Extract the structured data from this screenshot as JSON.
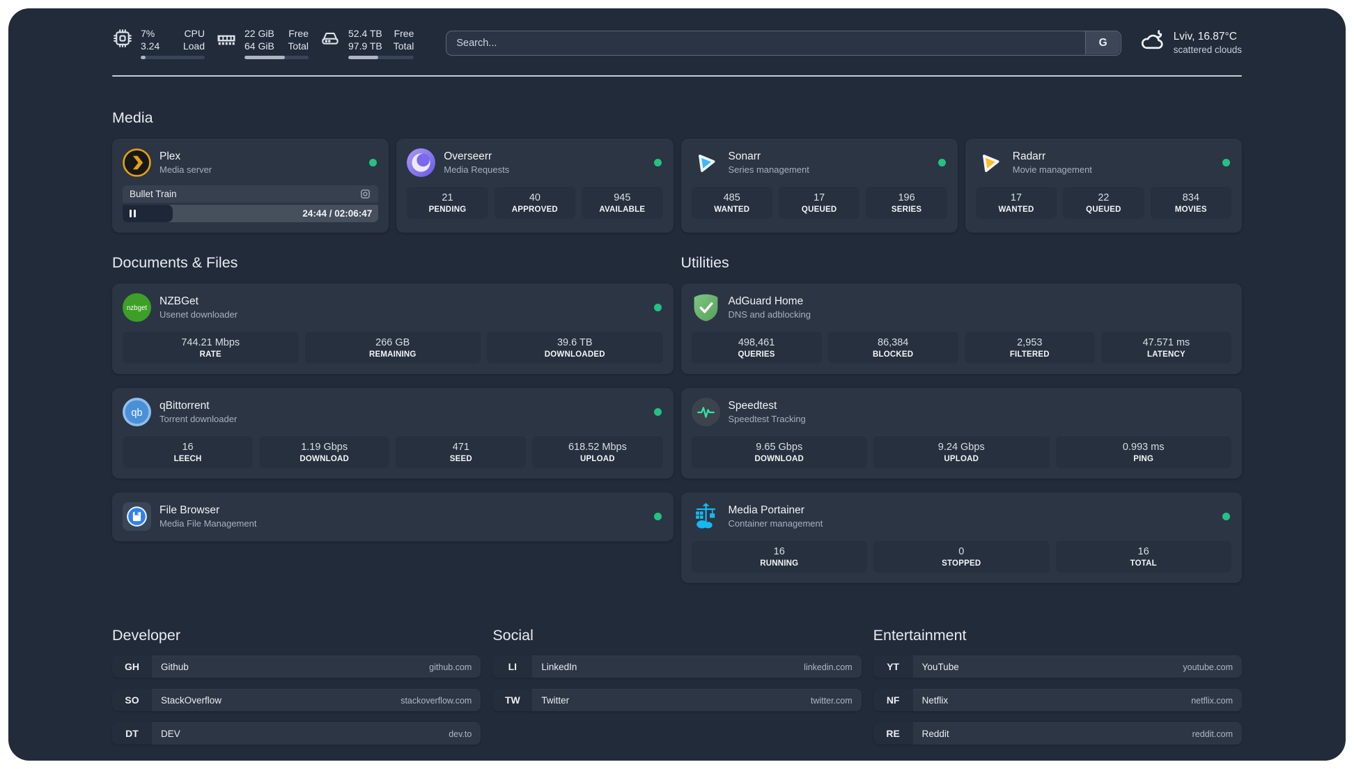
{
  "header": {
    "resources": [
      {
        "icon": "cpu-icon",
        "rows": [
          {
            "value": "7%",
            "label": "CPU"
          },
          {
            "value": "3.24",
            "label": "Load"
          }
        ],
        "fill_pct": 8
      },
      {
        "icon": "memory-icon",
        "rows": [
          {
            "value": "22 GiB",
            "label": "Free"
          },
          {
            "value": "64 GiB",
            "label": "Total"
          }
        ],
        "fill_pct": 63
      },
      {
        "icon": "disk-icon",
        "rows": [
          {
            "value": "52.4 TB",
            "label": "Free"
          },
          {
            "value": "97.9 TB",
            "label": "Total"
          }
        ],
        "fill_pct": 46
      }
    ],
    "search": {
      "placeholder": "Search...",
      "engine_button": "G"
    },
    "weather": {
      "icon": "cloud-icon",
      "location": "Lviv, 16.87°C",
      "condition": "scattered clouds"
    }
  },
  "sections": {
    "media": {
      "title": "Media",
      "apps": {
        "plex": {
          "name": "Plex",
          "desc": "Media server",
          "status": "online",
          "player": {
            "title": "Bullet Train",
            "time": "24:44 / 02:06:47",
            "progress_pct": 19.5,
            "state": "paused"
          }
        },
        "overseerr": {
          "name": "Overseerr",
          "desc": "Media Requests",
          "status": "online",
          "stats": [
            {
              "value": "21",
              "label": "PENDING"
            },
            {
              "value": "40",
              "label": "APPROVED"
            },
            {
              "value": "945",
              "label": "AVAILABLE"
            }
          ]
        },
        "sonarr": {
          "name": "Sonarr",
          "desc": "Series management",
          "status": "online",
          "stats": [
            {
              "value": "485",
              "label": "WANTED"
            },
            {
              "value": "17",
              "label": "QUEUED"
            },
            {
              "value": "196",
              "label": "SERIES"
            }
          ]
        },
        "radarr": {
          "name": "Radarr",
          "desc": "Movie management",
          "status": "online",
          "stats": [
            {
              "value": "17",
              "label": "WANTED"
            },
            {
              "value": "22",
              "label": "QUEUED"
            },
            {
              "value": "834",
              "label": "MOVIES"
            }
          ]
        }
      }
    },
    "documents": {
      "title": "Documents & Files",
      "apps": {
        "nzbget": {
          "name": "NZBGet",
          "desc": "Usenet downloader",
          "status": "online",
          "stats": [
            {
              "value": "744.21 Mbps",
              "label": "RATE"
            },
            {
              "value": "266 GB",
              "label": "REMAINING"
            },
            {
              "value": "39.6 TB",
              "label": "DOWNLOADED"
            }
          ]
        },
        "qbittorrent": {
          "name": "qBittorrent",
          "desc": "Torrent downloader",
          "status": "online",
          "stats": [
            {
              "value": "16",
              "label": "LEECH"
            },
            {
              "value": "1.19 Gbps",
              "label": "DOWNLOAD"
            },
            {
              "value": "471",
              "label": "SEED"
            },
            {
              "value": "618.52 Mbps",
              "label": "UPLOAD"
            }
          ]
        },
        "filebrowser": {
          "name": "File Browser",
          "desc": "Media File Management",
          "status": "online"
        }
      }
    },
    "utilities": {
      "title": "Utilities",
      "apps": {
        "adguard": {
          "name": "AdGuard Home",
          "desc": "DNS and adblocking",
          "stats": [
            {
              "value": "498,461",
              "label": "QUERIES"
            },
            {
              "value": "86,384",
              "label": "BLOCKED"
            },
            {
              "value": "2,953",
              "label": "FILTERED"
            },
            {
              "value": "47.571 ms",
              "label": "LATENCY"
            }
          ]
        },
        "speedtest": {
          "name": "Speedtest",
          "desc": "Speedtest Tracking",
          "stats": [
            {
              "value": "9.65 Gbps",
              "label": "DOWNLOAD"
            },
            {
              "value": "9.24 Gbps",
              "label": "UPLOAD"
            },
            {
              "value": "0.993 ms",
              "label": "PING"
            }
          ]
        },
        "portainer": {
          "name": "Media Portainer",
          "desc": "Container management",
          "status": "online",
          "stats": [
            {
              "value": "16",
              "label": "RUNNING"
            },
            {
              "value": "0",
              "label": "STOPPED"
            },
            {
              "value": "16",
              "label": "TOTAL"
            }
          ]
        }
      }
    }
  },
  "bookmarks": {
    "developer": {
      "title": "Developer",
      "items": [
        {
          "abbr": "GH",
          "name": "Github",
          "url": "github.com"
        },
        {
          "abbr": "SO",
          "name": "StackOverflow",
          "url": "stackoverflow.com"
        },
        {
          "abbr": "DT",
          "name": "DEV",
          "url": "dev.to"
        }
      ]
    },
    "social": {
      "title": "Social",
      "items": [
        {
          "abbr": "LI",
          "name": "LinkedIn",
          "url": "linkedin.com"
        },
        {
          "abbr": "TW",
          "name": "Twitter",
          "url": "twitter.com"
        }
      ]
    },
    "entertainment": {
      "title": "Entertainment",
      "items": [
        {
          "abbr": "YT",
          "name": "YouTube",
          "url": "youtube.com"
        },
        {
          "abbr": "NF",
          "name": "Netflix",
          "url": "netflix.com"
        },
        {
          "abbr": "RE",
          "name": "Reddit",
          "url": "reddit.com"
        }
      ]
    }
  },
  "colors": {
    "status_online": "#25c183",
    "accent_plex": "#e5a00d",
    "accent_sonarr": "#38bdf8",
    "accent_radarr": "#fbbf24",
    "accent_nzbget": "#3d9f27",
    "accent_qbittorrent": "#4a90d9",
    "accent_filebrowser": "#2f80ed",
    "accent_adguard": "#63b568",
    "accent_speedtest": "#2fe6a8",
    "accent_portainer": "#18b8f0",
    "progress_fill": "#aeb6c3"
  }
}
